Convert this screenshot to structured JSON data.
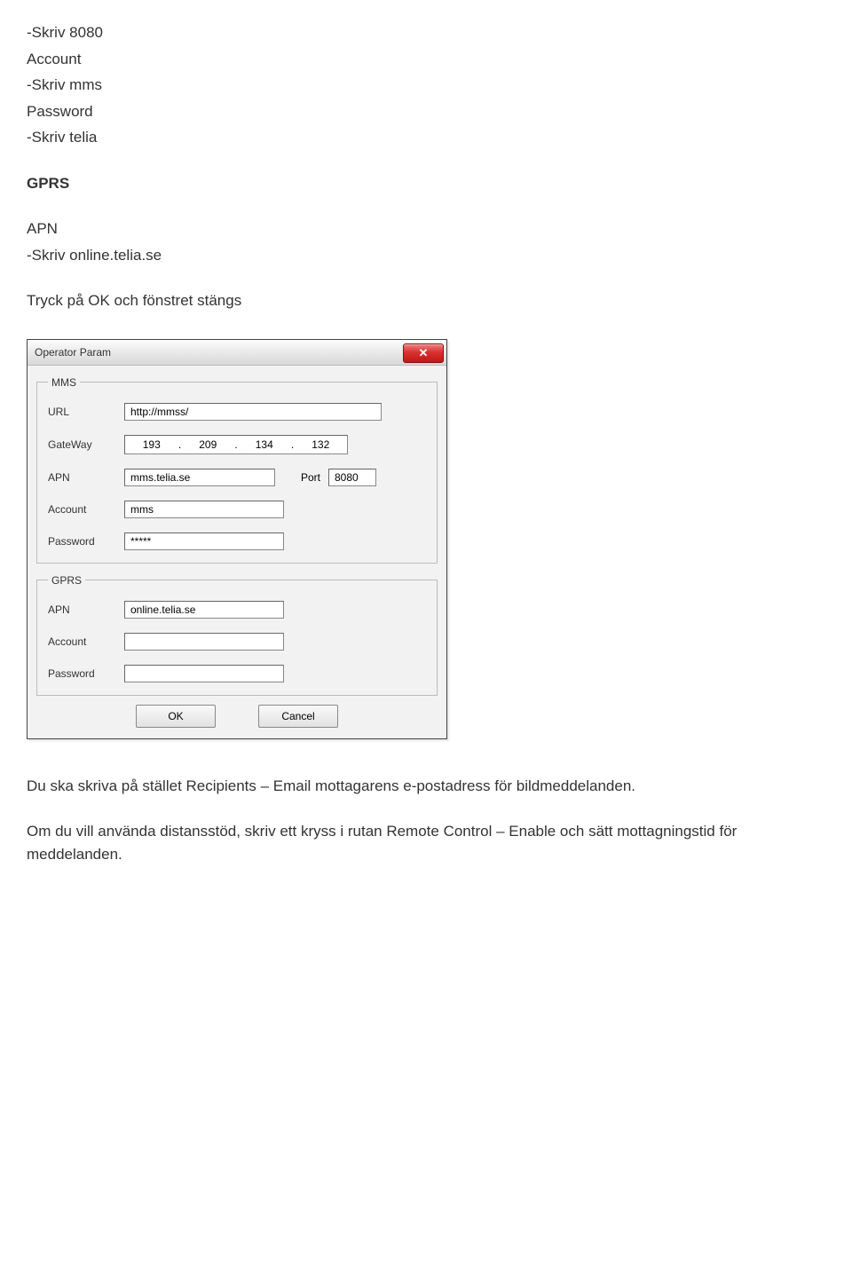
{
  "doc": {
    "line1": "-Skriv 8080",
    "line2": "Account",
    "line3": "-Skriv mms",
    "line4": "Password",
    "line5": "-Skriv telia",
    "gprs_heading": "GPRS",
    "line6": "APN",
    "line7": "-Skriv online.telia.se",
    "line8": "Tryck på OK och fönstret stängs",
    "para1": "Du ska skriva på stället Recipients – Email mottagarens e-postadress för bildmeddelanden.",
    "para2": "Om du vill använda distansstöd, skriv ett kryss i rutan Remote Control – Enable och sätt mottagningstid för meddelanden."
  },
  "dialog": {
    "title": "Operator Param",
    "mms": {
      "legend": "MMS",
      "url_label": "URL",
      "url_value": "http://mmss/",
      "gateway_label": "GateWay",
      "gateway_ip": [
        "193",
        "209",
        "134",
        "132"
      ],
      "apn_label": "APN",
      "apn_value": "mms.telia.se",
      "port_label": "Port",
      "port_value": "8080",
      "account_label": "Account",
      "account_value": "mms",
      "password_label": "Password",
      "password_value": "*****"
    },
    "gprs": {
      "legend": "GPRS",
      "apn_label": "APN",
      "apn_value": "online.telia.se",
      "account_label": "Account",
      "account_value": "",
      "password_label": "Password",
      "password_value": ""
    },
    "buttons": {
      "ok": "OK",
      "cancel": "Cancel"
    }
  }
}
